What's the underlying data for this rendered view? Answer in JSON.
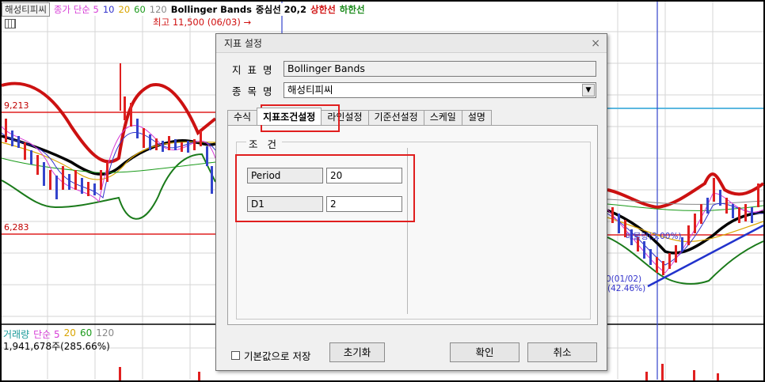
{
  "chart": {
    "stock_name": "해성티피씨",
    "legend_items": [
      {
        "text": "종가 단순 5",
        "color": "#d63bd6"
      },
      {
        "text": "10",
        "color": "#3333cc"
      },
      {
        "text": "20",
        "color": "#d9a500"
      },
      {
        "text": "60",
        "color": "#1a9a1a"
      },
      {
        "text": "120",
        "color": "#888888"
      }
    ],
    "indicator_title": "Bollinger Bands",
    "indicator_sub": "중심선 20,2",
    "upper_label": "상한선",
    "lower_label": "하한선",
    "high_label": "최고 11,500 (06/03) →",
    "price_upper": "9,213",
    "price_lower": "6,283",
    "volume_legend": [
      {
        "text": "거래량",
        "color": "#1a9a9a"
      },
      {
        "text": "단순 5",
        "color": "#d63bd6"
      },
      {
        "text": "20",
        "color": "#d9a500"
      },
      {
        "text": "60",
        "color": "#1a9a1a"
      },
      {
        "text": "120",
        "color": "#888888"
      }
    ],
    "volume_value": "1,941,678주(285.66%)",
    "annotation_1": "매물량(3.00%)",
    "annotation_2": "0(01/02)",
    "annotation_3": "(42.46%)"
  },
  "dialog": {
    "title": "지표 설정",
    "close_symbol": "×",
    "indicator_name_label": "지 표 명",
    "indicator_name_value": "Bollinger Bands",
    "item_name_label": "종 목 명",
    "item_name_value": "해성티피씨",
    "tabs": [
      {
        "label": "수식",
        "active": false
      },
      {
        "label": "지표조건설정",
        "active": true
      },
      {
        "label": "라인설정",
        "active": false
      },
      {
        "label": "기준선설정",
        "active": false
      },
      {
        "label": "스케일",
        "active": false
      },
      {
        "label": "설명",
        "active": false
      }
    ],
    "condition_group": "조 건",
    "params": [
      {
        "label": "Period",
        "value": "20"
      },
      {
        "label": "D1",
        "value": "2"
      }
    ],
    "default_save_label": "기본값으로 저장",
    "reset_button": "초기화",
    "ok_button": "확인",
    "cancel_button": "취소"
  }
}
